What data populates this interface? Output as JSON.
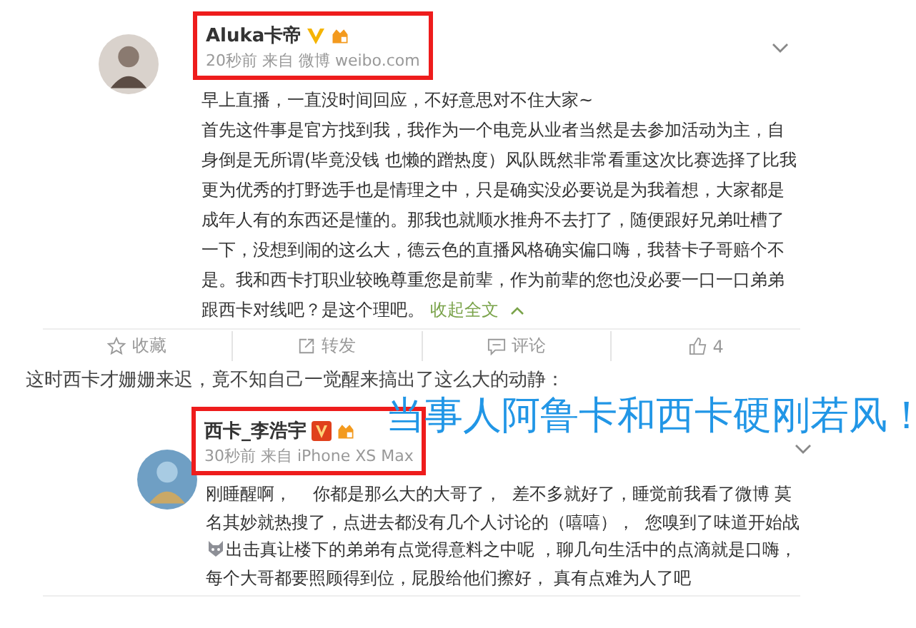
{
  "posts": [
    {
      "name": "Aluka卡帝",
      "kind": "gold_v",
      "meta": "20秒前 来自 微博 weibo.com",
      "paragraphs": [
        [
          {
            "kind": "text",
            "text": "早上直播，一直没时间回应，不好意思对不住大家~"
          }
        ],
        [
          {
            "kind": "text",
            "text": "首先这件事是官方找到我，我作为一个电竞从业者当然是去参加活动为主，自身倒是无所谓(毕竟没钱 也懒的蹭热度）风队既然非常看重这次比赛选择了比我更为优秀的打野选手也是情理之中，只是确实没必要说是为我着想，大家都是成年人有的东西还是懂的。那我也就顺水推舟不去打了，随便跟好兄弟吐槽了一下，没想到闹的这么大，德云色的直播风格确实偏口嗨，我替卡子哥赔个不是。我和西卡打职业较晚尊重您是前辈，作为前辈的您也没必要一口一口弟弟跟西卡对线吧？是这个理吧。 "
          },
          {
            "kind": "link",
            "text": "收起全文"
          }
        ]
      ],
      "actions": [
        {
          "kind": "star",
          "label": "收藏"
        },
        {
          "kind": "share",
          "label": "转发"
        },
        {
          "kind": "comment",
          "label": "评论"
        },
        {
          "kind": "like",
          "label": "4"
        }
      ]
    },
    {
      "name": "西卡_李浩宇",
      "kind": "red_v",
      "meta": "30秒前 来自 iPhone XS Max",
      "paragraphs": [
        [
          {
            "kind": "text",
            "text": "刚睡醒啊，    你都是那么大的大哥了，  差不多就好了，睡觉前我看了微博 莫名其妙就热搜了，点进去都没有几个人讨论的（嘻嘻），  您嗅到了味道开始战"
          },
          {
            "kind": "emoji"
          },
          {
            "kind": "text",
            "text": "出击真让楼下的弟弟有点觉得意料之中呢 ，聊几句生活中的点滴就是口嗨，每个大哥都要照顾得到位，屁股给他们擦好， 真有点难为人了吧"
          }
        ]
      ]
    }
  ],
  "caption": "这时西卡才姗姗来迟，竟不知自己一觉醒来搞出了这么大的动静：",
  "headline": "当事人阿鲁卡和西卡硬刚若风！"
}
